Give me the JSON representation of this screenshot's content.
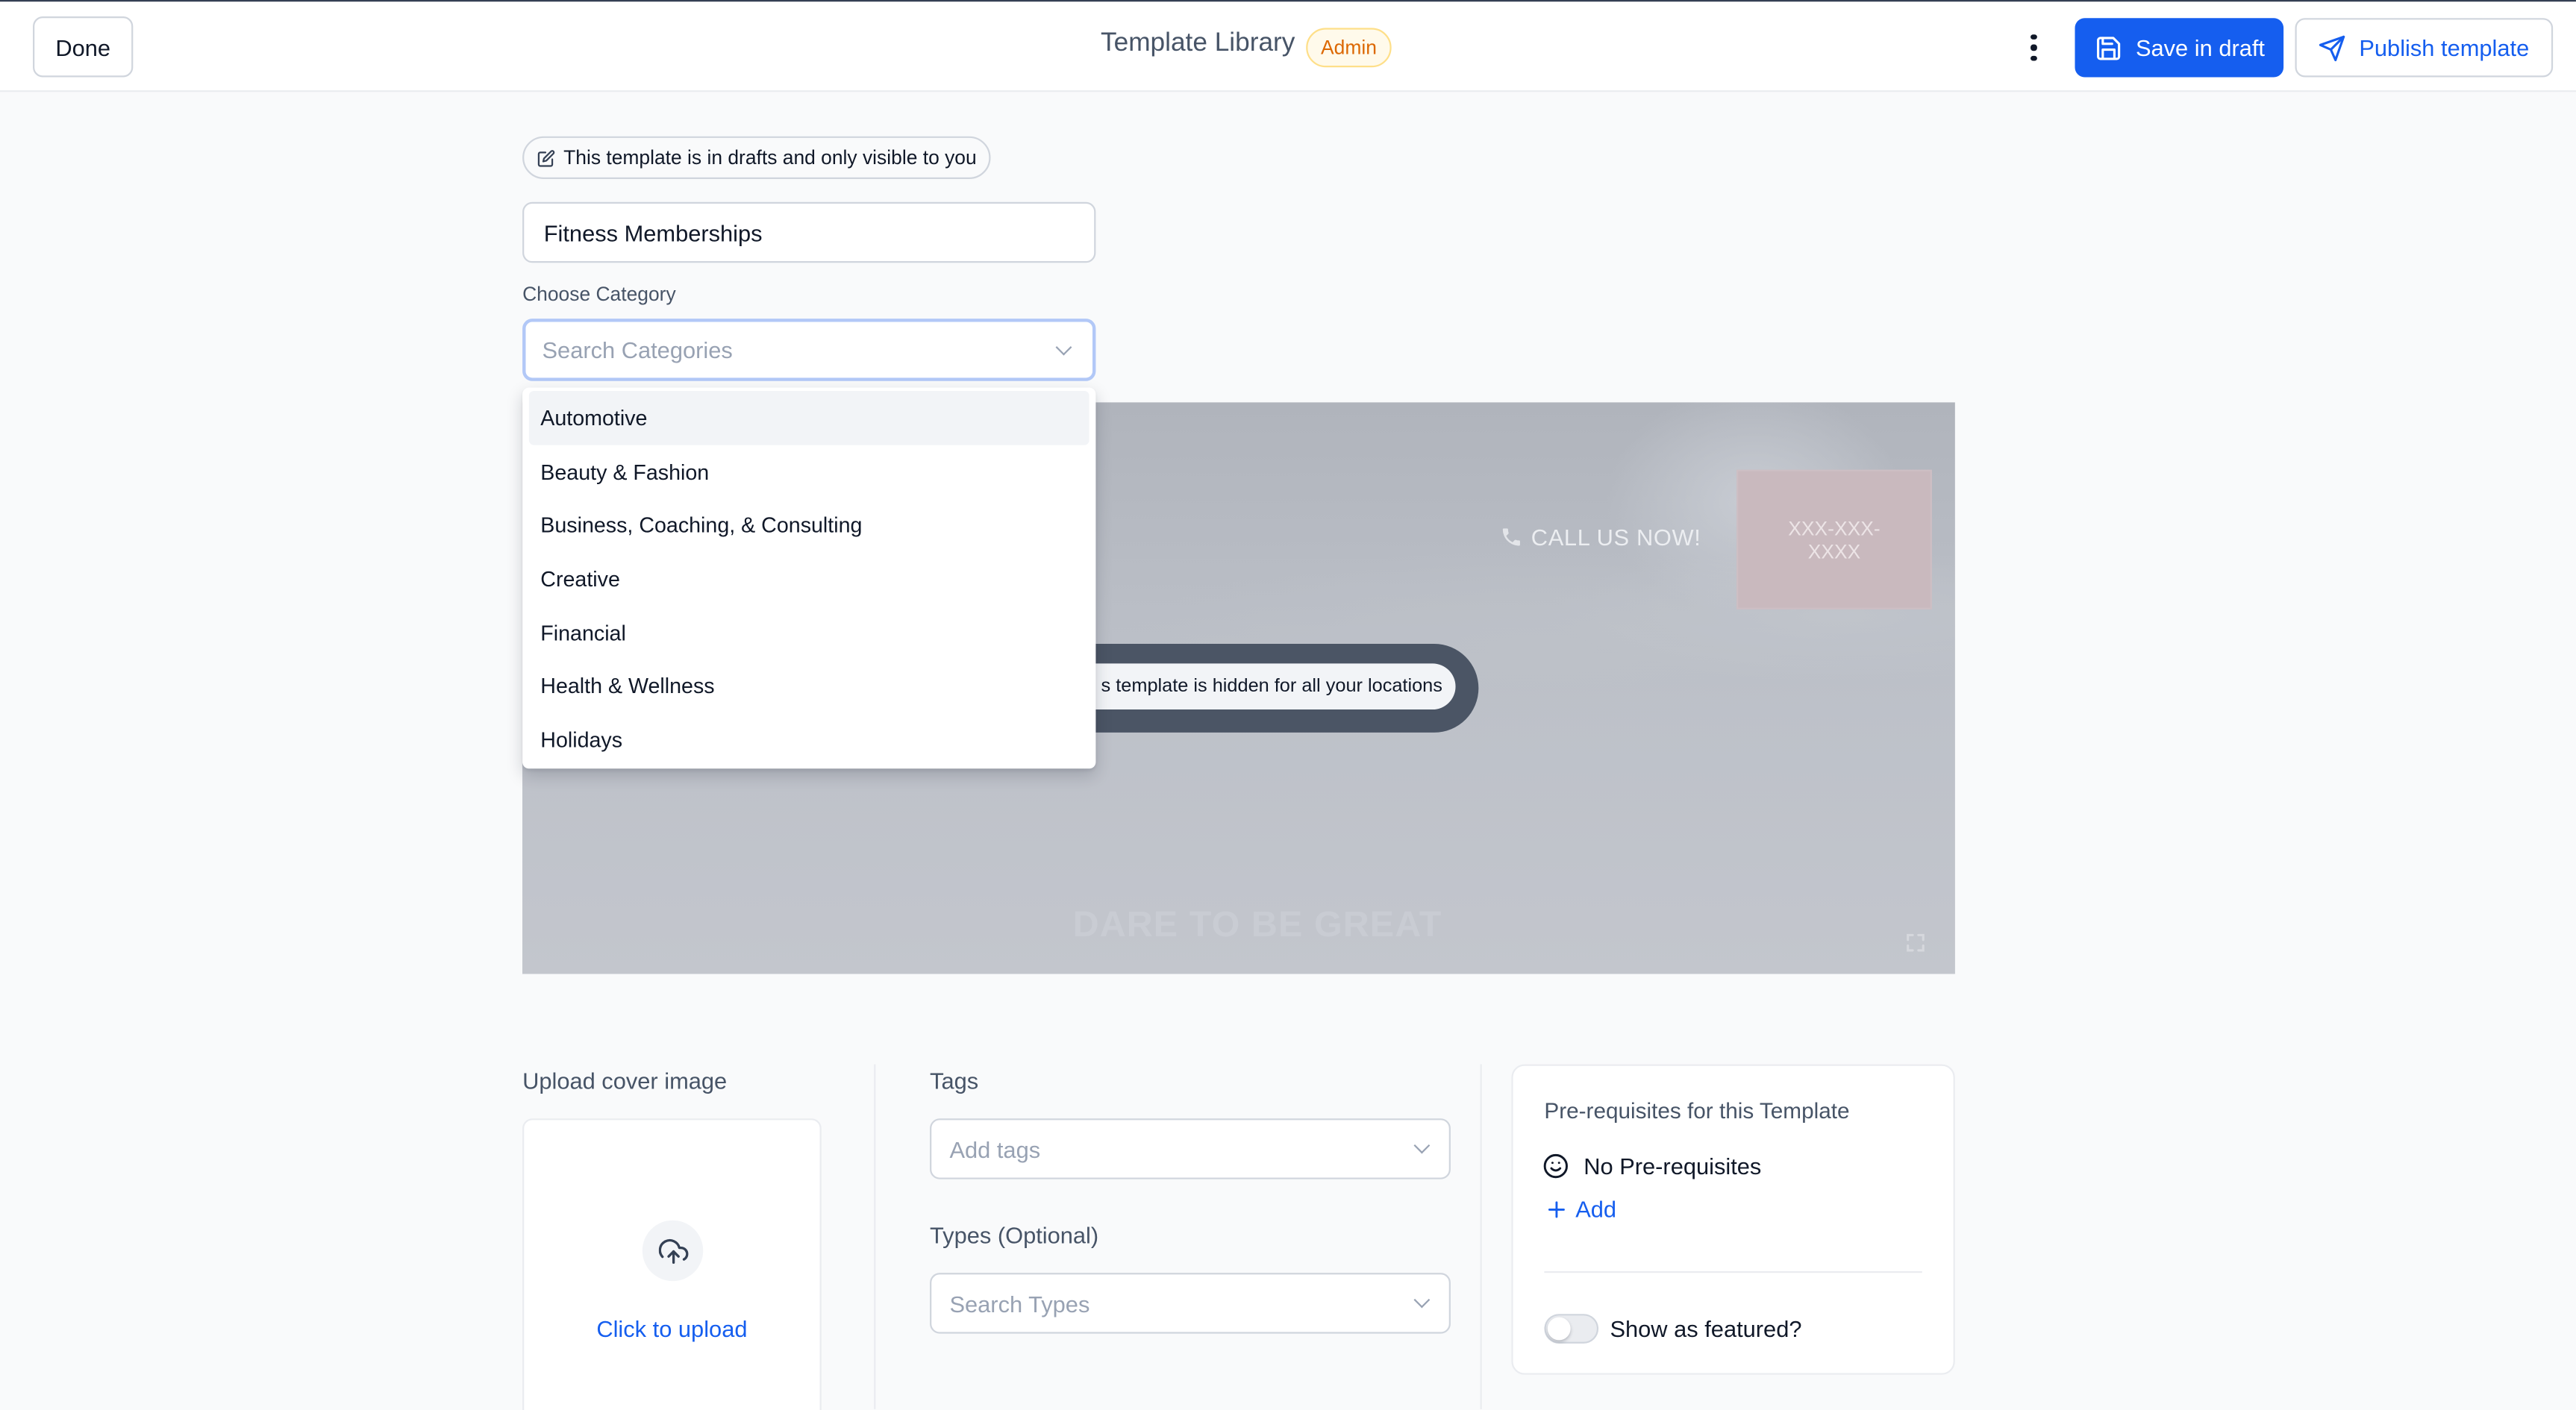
{
  "header": {
    "done_label": "Done",
    "title": "Template Library",
    "badge": "Admin",
    "save_label": "Save in draft",
    "publish_label": "Publish template"
  },
  "draft_notice": "This template is in drafts and only visible to you",
  "template_name": "Fitness Memberships",
  "category": {
    "label": "Choose Category",
    "placeholder": "Search Categories",
    "options": [
      "Automotive",
      "Beauty & Fashion",
      "Business, Coaching, & Consulting",
      "Creative",
      "Financial",
      "Health & Wellness",
      "Holidays"
    ],
    "highlighted": "Automotive"
  },
  "preview": {
    "call_text": "CALL US NOW!",
    "phone_line1": "XXX-XXX-",
    "phone_line2": "XXXX",
    "hidden_notice": "s template is hidden for all your locations",
    "headline": "DARE TO BE GREAT"
  },
  "upload": {
    "label": "Upload cover image",
    "action": "Click to upload"
  },
  "tags": {
    "label": "Tags",
    "placeholder": "Add tags"
  },
  "types": {
    "label": "Types (Optional)",
    "placeholder": "Search Types"
  },
  "prerequisites": {
    "title": "Pre-requisites for this Template",
    "none_text": "No Pre-requisites",
    "add_label": "Add",
    "featured_label": "Show as featured?",
    "featured_on": false
  },
  "colors": {
    "primary": "#155eef",
    "badge_text": "#dc6803",
    "badge_bg": "#fffaeb"
  }
}
